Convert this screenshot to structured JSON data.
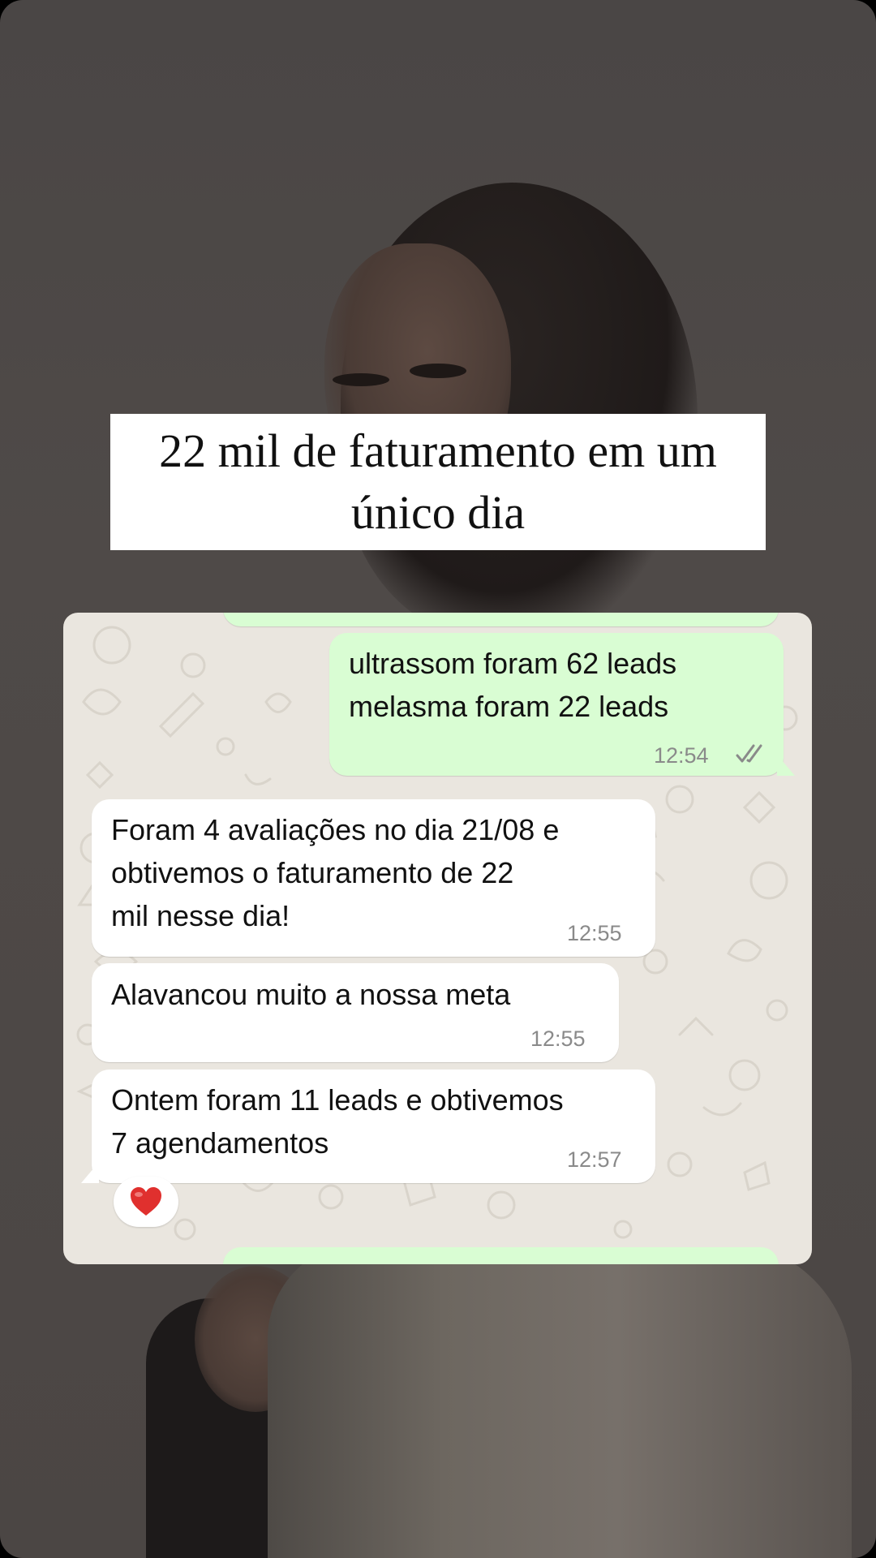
{
  "caption": {
    "text": "22 mil de faturamento em um único dia"
  },
  "chat": {
    "messages": [
      {
        "direction": "out",
        "text": "ultrassom foram 62 leads\nmelasma foram 22 leads",
        "time": "12:54",
        "status": "read"
      },
      {
        "direction": "in",
        "text": "Foram 4 avaliações no dia 21/08 e\nobtivemos o faturamento de 22\nmil nesse dia!",
        "time": "12:55"
      },
      {
        "direction": "in",
        "text": "Alavancou muito a nossa meta",
        "time": "12:55"
      },
      {
        "direction": "in",
        "text": "Ontem foram 11 leads e obtivemos\n7 agendamentos",
        "time": "12:57",
        "reaction": "heart"
      }
    ]
  },
  "colors": {
    "outgoing_bubble": "#d9fdd3",
    "incoming_bubble": "#ffffff",
    "chat_wallpaper": "#eae6df",
    "read_ticks": "#8a8a8a",
    "reaction_heart": "#e0302e"
  }
}
